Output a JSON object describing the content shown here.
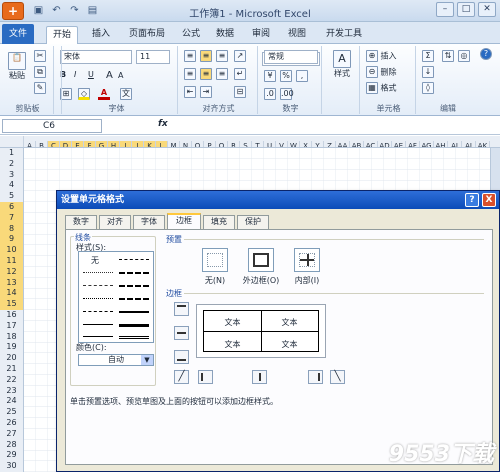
{
  "window": {
    "title": "工作簿1 - Microsoft Excel"
  },
  "ribbon_tabs": [
    "文件",
    "开始",
    "插入",
    "页面布局",
    "公式",
    "数据",
    "审阅",
    "视图",
    "开发工具"
  ],
  "ribbon": {
    "clipboard": {
      "paste": "粘贴",
      "label": "剪贴板"
    },
    "font": {
      "name": "宋体",
      "size": "11",
      "bold": "B",
      "italic": "I",
      "underline": "U",
      "grow": "A",
      "shrink": "A",
      "label": "字体"
    },
    "alignment": {
      "label": "对齐方式"
    },
    "number": {
      "format": "常规",
      "label": "数字"
    },
    "styles": {
      "label": "样式"
    },
    "cells": {
      "insert": "插入",
      "delete": "删除",
      "format": "格式",
      "label": "单元格"
    },
    "editing": {
      "label": "编辑"
    }
  },
  "formula_bar": {
    "name_box": "C6",
    "fx": "fx"
  },
  "columns": [
    "A",
    "B",
    "C",
    "D",
    "E",
    "F",
    "G",
    "H",
    "I",
    "J",
    "K",
    "L",
    "M",
    "N",
    "O",
    "P",
    "Q",
    "R",
    "S",
    "T",
    "U",
    "V",
    "W",
    "X",
    "Y",
    "Z",
    "AA",
    "AB",
    "AC",
    "AD",
    "AE",
    "AF",
    "AG",
    "AH",
    "AI",
    "AJ",
    "AK"
  ],
  "selected_columns": [
    "C",
    "D",
    "E",
    "F",
    "G",
    "H",
    "I",
    "J",
    "K",
    "L"
  ],
  "rows": [
    "1",
    "2",
    "3",
    "4",
    "5",
    "6",
    "7",
    "8",
    "9",
    "10",
    "11",
    "12",
    "13",
    "14",
    "15",
    "16",
    "17",
    "18",
    "19",
    "20",
    "21",
    "22",
    "23",
    "24",
    "25",
    "26",
    "27",
    "28",
    "29",
    "30"
  ],
  "selected_rows": [
    "6",
    "7",
    "8",
    "9",
    "10",
    "11",
    "12",
    "13",
    "14",
    "15"
  ],
  "dialog": {
    "title": "设置单元格格式",
    "help": "?",
    "close": "X",
    "tabs": [
      "数字",
      "对齐",
      "字体",
      "边框",
      "填充",
      "保护"
    ],
    "active_tab": "边框",
    "line_group": "线条",
    "style_label": "样式(S):",
    "style_none": "无",
    "color_label": "颜色(C):",
    "color_value": "自动",
    "preset_group": "预置",
    "presets": [
      "无(N)",
      "外边框(O)",
      "内部(I)"
    ],
    "border_group": "边框",
    "preview_cells": [
      "文本",
      "文本",
      "文本",
      "文本"
    ],
    "note": "单击预置选项、预览草图及上面的按钮可以添加边框样式。"
  },
  "watermark": "9553下载"
}
